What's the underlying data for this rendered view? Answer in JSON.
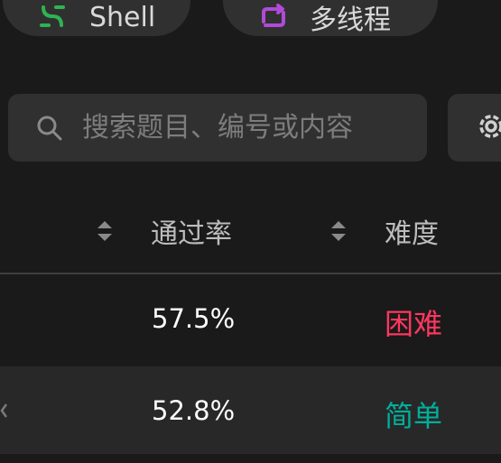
{
  "tags": [
    {
      "label": "Shell",
      "icon": "dollar-icon",
      "icon_color": "#2eb352"
    },
    {
      "label": "多线程",
      "icon": "repeat-icon",
      "icon_color": "#b04ad9"
    }
  ],
  "search": {
    "placeholder": "搜索题目、编号或内容",
    "value": ""
  },
  "settings": {
    "icon": "gear-icon"
  },
  "table": {
    "headers": {
      "acceptance": "通过率",
      "difficulty": "难度"
    },
    "rows": [
      {
        "acceptance": "57.5%",
        "difficulty": "困难",
        "difficulty_color": "#ff375f"
      },
      {
        "acceptance": "52.8%",
        "difficulty": "简单",
        "difficulty_color": "#00af9b"
      }
    ]
  }
}
